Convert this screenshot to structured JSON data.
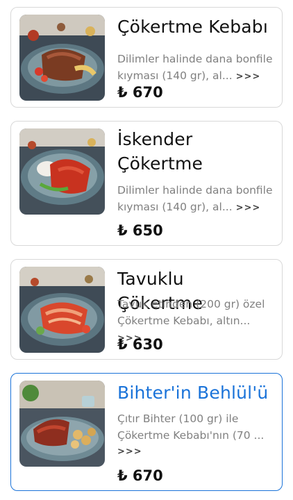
{
  "menu": {
    "items": [
      {
        "title": "Çökertme Kebabı",
        "desc_line1": "Dilimler halinde dana bonfile",
        "desc_line2": "kıyması (140 gr), al...",
        "more": ">>>",
        "price": "₺ 670",
        "image": "cokertme-kebabi-photo"
      },
      {
        "title_line1": "İskender",
        "title_line2": "Çökertme",
        "desc_line1": "Dilimler halinde dana bonfile",
        "desc_line2": "kıyması (140 gr), al...",
        "more": ">>>",
        "price": "₺ 650",
        "image": "iskender-cokertme-photo"
      },
      {
        "title": "Tavuklu Çökertme",
        "desc_line1": "Tavuk etinden (200 gr) özel",
        "desc_line2": "Çökertme Kebabı, altın...",
        "more": ">>>",
        "price": "₺ 630",
        "image": "tavuklu-cokertme-photo"
      },
      {
        "title": "Bihter'in Behlül'ü",
        "desc_line1": "Çıtır Bihter (100 gr) ile",
        "desc_line2": "Çökertme Kebabı'nın (70 ...",
        "more": ">>>",
        "price": "₺ 670",
        "image": "bihterin-behlulu-photo",
        "selected": true
      }
    ]
  },
  "colors": {
    "accent": "#1a73d9",
    "text": "#111111",
    "muted": "#808080",
    "border": "#d8d8d8"
  }
}
